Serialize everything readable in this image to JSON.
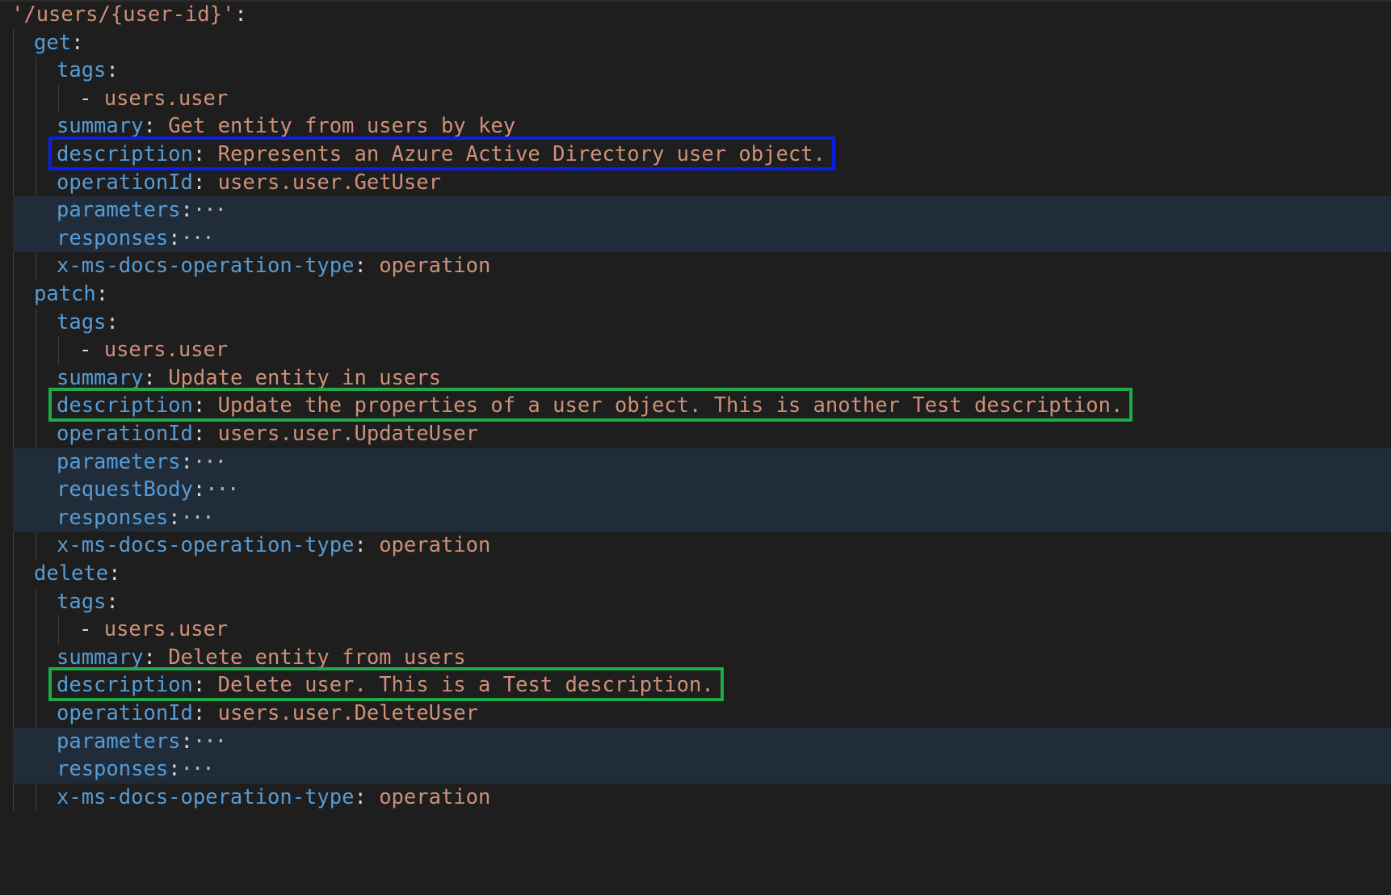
{
  "editor": {
    "language": "yaml",
    "theme_colors": {
      "background": "#1e1e1e",
      "key": "#569cd6",
      "string": "#ce9178",
      "punctuation": "#d4d4d4",
      "folded_region": "#212c3a",
      "highlight_blue": "#0b1ee6",
      "highlight_green": "#20a94a"
    },
    "lines": [
      {
        "indent": 0,
        "key": "'/users/{user-id}'",
        "key_is_string": true,
        "colon": ":",
        "value": ""
      },
      {
        "indent": 1,
        "key": "get",
        "colon": ":",
        "value": ""
      },
      {
        "indent": 2,
        "key": "tags",
        "colon": ":",
        "value": ""
      },
      {
        "indent": 3,
        "dash": "- ",
        "value": "users.user"
      },
      {
        "indent": 2,
        "key": "summary",
        "colon": ": ",
        "value": "Get entity from users by key"
      },
      {
        "indent": 2,
        "key": "description",
        "colon": ": ",
        "value": "Represents an Azure Active Directory user object.",
        "highlight": "blue"
      },
      {
        "indent": 2,
        "key": "operationId",
        "colon": ": ",
        "value": "users.user.GetUser"
      },
      {
        "indent": 2,
        "key": "parameters",
        "colon": ":",
        "folded": true,
        "ellipsis": "···"
      },
      {
        "indent": 2,
        "key": "responses",
        "colon": ":",
        "folded": true,
        "ellipsis": "···"
      },
      {
        "indent": 2,
        "key": "x-ms-docs-operation-type",
        "colon": ": ",
        "value": "operation"
      },
      {
        "indent": 1,
        "key": "patch",
        "colon": ":",
        "value": ""
      },
      {
        "indent": 2,
        "key": "tags",
        "colon": ":",
        "value": ""
      },
      {
        "indent": 3,
        "dash": "- ",
        "value": "users.user"
      },
      {
        "indent": 2,
        "key": "summary",
        "colon": ": ",
        "value": "Update entity in users"
      },
      {
        "indent": 2,
        "key": "description",
        "colon": ": ",
        "value": "Update the properties of a user object. This is another Test description.",
        "highlight": "green"
      },
      {
        "indent": 2,
        "key": "operationId",
        "colon": ": ",
        "value": "users.user.UpdateUser"
      },
      {
        "indent": 2,
        "key": "parameters",
        "colon": ":",
        "folded": true,
        "ellipsis": "···"
      },
      {
        "indent": 2,
        "key": "requestBody",
        "colon": ":",
        "folded": true,
        "ellipsis": "···"
      },
      {
        "indent": 2,
        "key": "responses",
        "colon": ":",
        "folded": true,
        "ellipsis": "···"
      },
      {
        "indent": 2,
        "key": "x-ms-docs-operation-type",
        "colon": ": ",
        "value": "operation"
      },
      {
        "indent": 1,
        "key": "delete",
        "colon": ":",
        "value": ""
      },
      {
        "indent": 2,
        "key": "tags",
        "colon": ":",
        "value": ""
      },
      {
        "indent": 3,
        "dash": "- ",
        "value": "users.user"
      },
      {
        "indent": 2,
        "key": "summary",
        "colon": ": ",
        "value": "Delete entity from users"
      },
      {
        "indent": 2,
        "key": "description",
        "colon": ": ",
        "value": "Delete user. This is a Test description.",
        "highlight": "green"
      },
      {
        "indent": 2,
        "key": "operationId",
        "colon": ": ",
        "value": "users.user.DeleteUser"
      },
      {
        "indent": 2,
        "key": "parameters",
        "colon": ":",
        "folded": true,
        "ellipsis": "···"
      },
      {
        "indent": 2,
        "key": "responses",
        "colon": ":",
        "folded": true,
        "ellipsis": "···"
      },
      {
        "indent": 2,
        "key": "x-ms-docs-operation-type",
        "colon": ": ",
        "value": "operation"
      }
    ]
  }
}
